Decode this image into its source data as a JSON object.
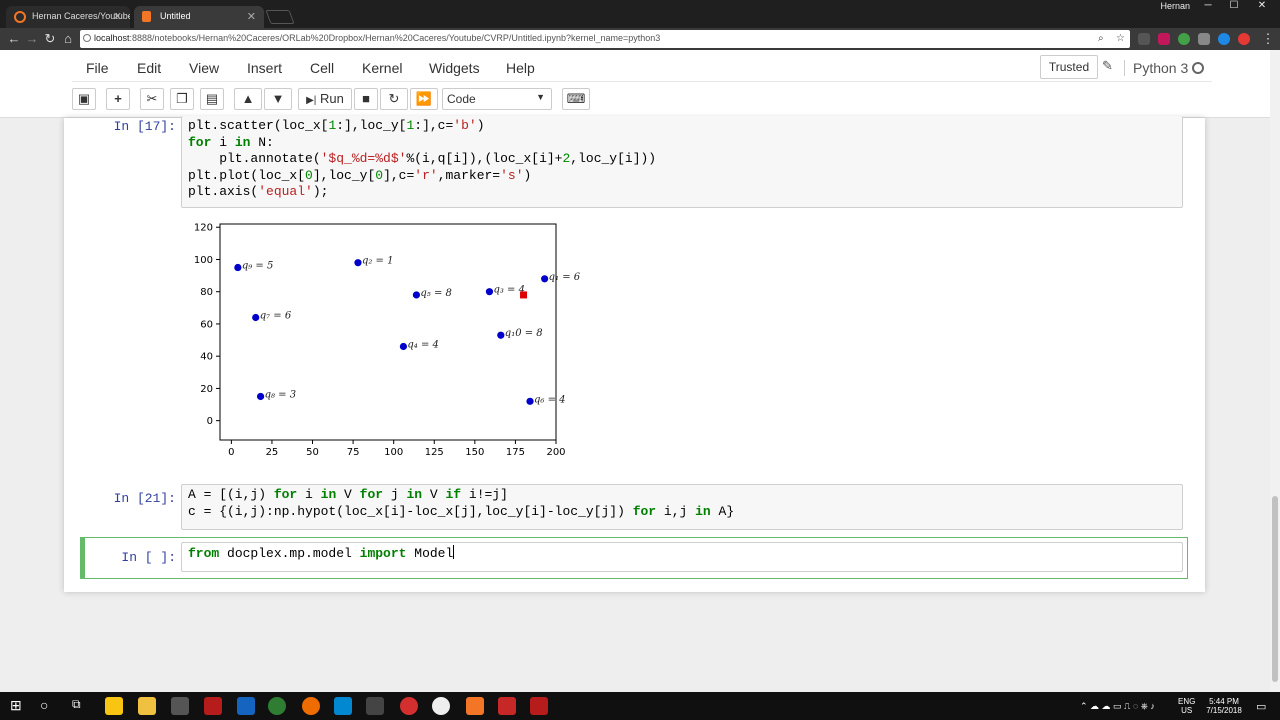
{
  "browser": {
    "tabs": [
      {
        "title": "Hernan Caceres/Youtube",
        "active": false
      },
      {
        "title": "Untitled",
        "active": true
      }
    ],
    "user": "Hernan",
    "url_host": "localhost",
    "url_rest": ":8888/notebooks/Hernan%20Caceres/ORLab%20Dropbox/Hernan%20Caceres/Youtube/CVRP/Untitled.ipynb?kernel_name=python3"
  },
  "menu": {
    "items": [
      "File",
      "Edit",
      "View",
      "Insert",
      "Cell",
      "Kernel",
      "Widgets",
      "Help"
    ],
    "trusted": "Trusted",
    "kernel": "Python 3"
  },
  "toolbar": {
    "run_label": "Run",
    "cell_type": "Code"
  },
  "cells": {
    "c17": {
      "prompt": "In [17]:",
      "lines": [
        "plt.scatter(loc_x[1:],loc_y[1:],c='b')",
        "for i in N:",
        "    plt.annotate('$q_%d=%d$'%(i,q[i]),(loc_x[i]+2,loc_y[i]))",
        "plt.plot(loc_x[0],loc_y[0],c='r',marker='s')",
        "plt.axis('equal');"
      ]
    },
    "c21": {
      "prompt": "In [21]:",
      "lines": [
        "A = [(i,j) for i in V for j in V if i!=j]",
        "c = {(i,j):np.hypot(loc_x[i]-loc_x[j],loc_y[i]-loc_y[j]) for i,j in A}"
      ]
    },
    "c_new": {
      "prompt": "In [ ]:",
      "code": "from docplex.mp.model import Model"
    }
  },
  "chart_data": {
    "type": "scatter",
    "xlim": [
      -7,
      200
    ],
    "ylim": [
      -12,
      122
    ],
    "xticks": [
      0,
      25,
      50,
      75,
      100,
      125,
      150,
      175,
      200
    ],
    "yticks": [
      0,
      20,
      40,
      60,
      80,
      100,
      120
    ],
    "points": [
      {
        "x": 4,
        "y": 95,
        "label": "q₉ = 5"
      },
      {
        "x": 78,
        "y": 98,
        "label": "q₂ = 1"
      },
      {
        "x": 114,
        "y": 78,
        "label": "q₅ = 8"
      },
      {
        "x": 159,
        "y": 80,
        "label": "q₃ = 4"
      },
      {
        "x": 193,
        "y": 88,
        "label": "q₁ = 6"
      },
      {
        "x": 15,
        "y": 64,
        "label": "q₇ = 6"
      },
      {
        "x": 106,
        "y": 46,
        "label": "q₄ = 4"
      },
      {
        "x": 166,
        "y": 53,
        "label": "q₁0 = 8"
      },
      {
        "x": 18,
        "y": 15,
        "label": "q₈ = 3"
      },
      {
        "x": 184,
        "y": 12,
        "label": "q₆ = 4"
      }
    ],
    "depot": {
      "x": 180,
      "y": 78
    },
    "point_color": "#0000cc",
    "depot_color": "#dd0000"
  },
  "taskbar": {
    "lang_top": "ENG",
    "lang_bottom": "US",
    "time": "5:44 PM",
    "date": "7/15/2018"
  }
}
